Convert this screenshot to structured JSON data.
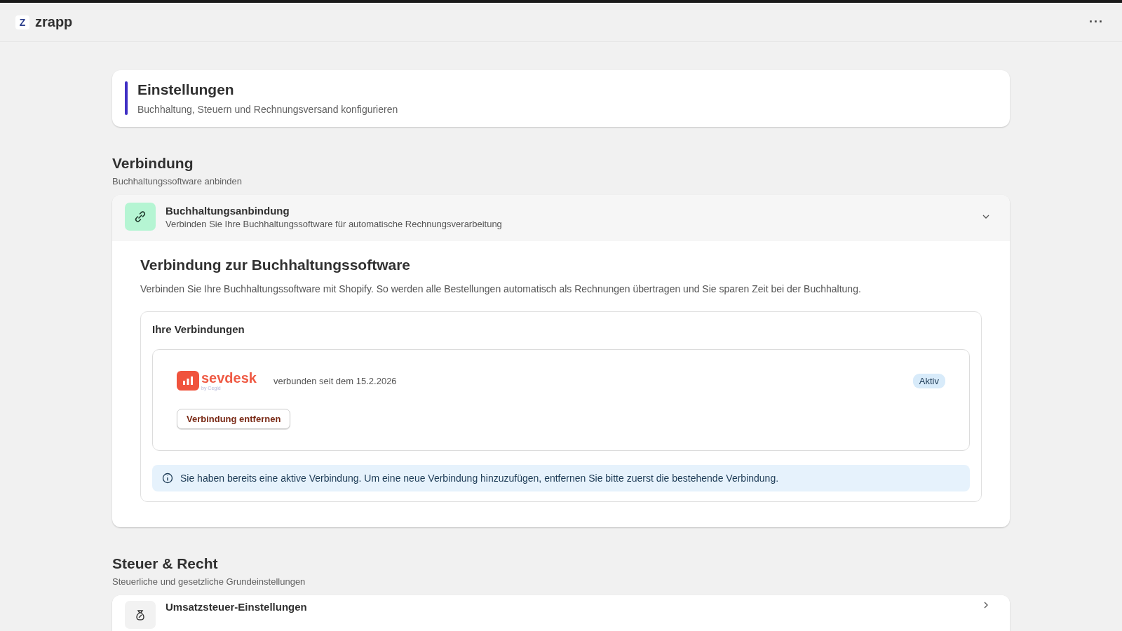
{
  "app": {
    "logo_letter": "Z",
    "name": "zrapp",
    "menu_glyph": "···"
  },
  "header": {
    "title": "Einstellungen",
    "subtitle": "Buchhaltung, Steuern und Rechnungsversand konfigurieren"
  },
  "sections": [
    {
      "title": "Verbindung",
      "subtitle": "Buchhaltungssoftware anbinden",
      "panels": [
        {
          "title": "Buchhaltungsanbindung",
          "subtitle": "Verbinden Sie Ihre Buchhaltungssoftware für automatische Rechnungsverarbeitung",
          "expanded": true,
          "body": {
            "heading": "Verbindung zur Buchhaltungssoftware",
            "text": "Verbinden Sie Ihre Buchhaltungssoftware mit Shopify. So werden alle Bestellungen automatisch als Rechnungen übertragen und Sie sparen Zeit bei der Buchhaltung.",
            "connections_title": "Ihre Verbindungen",
            "connections": [
              {
                "wordmark": "sevdesk",
                "tagline": "by Cegid",
                "since": "verbunden seit dem 15.2.2026",
                "status": "Aktiv",
                "action": "Verbindung entfernen"
              }
            ],
            "info": "Sie haben bereits eine aktive Verbindung. Um eine neue Verbindung hinzuzufügen, entfernen Sie bitte zuerst die bestehende Verbindung."
          }
        }
      ]
    },
    {
      "title": "Steuer & Recht",
      "subtitle": "Steuerliche und gesetzliche Grundeinstellungen",
      "panels": [
        {
          "title": "Umsatzsteuer-Einstellungen",
          "expanded": false
        }
      ]
    }
  ]
}
